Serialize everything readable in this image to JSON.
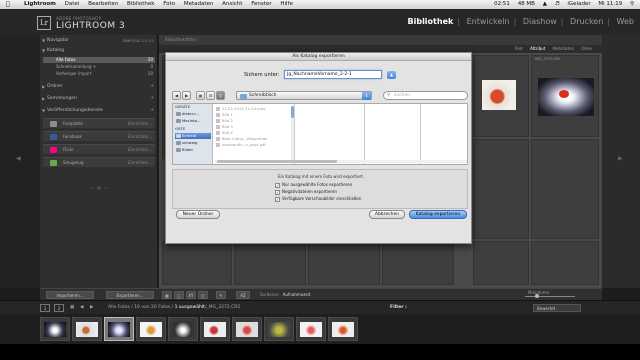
{
  "menubar": {
    "app": "Lightroom",
    "menus": [
      "Datei",
      "Bearbeiten",
      "Bibliothek",
      "Foto",
      "Metadaten",
      "Ansicht",
      "Fenster",
      "Hilfe"
    ],
    "time_left": "02:51",
    "memory": "48 MB",
    "user": "iGelader",
    "clock": "Mi 11:19"
  },
  "app": {
    "badge": "Lr",
    "small": "ADOBE PHOTOSHOP",
    "title": "LIGHTROOM 3",
    "modules": [
      "Bibliothek",
      "Entwickeln",
      "Diashow",
      "Drucken",
      "Web"
    ],
    "active_module": "Bibliothek"
  },
  "left_panel": {
    "navigator": "Navigator",
    "navigator_modes": "EINP  FÜLL  1:1  3:1",
    "catalog": "Katalog",
    "catalog_items": [
      {
        "label": "Alle Fotos",
        "count": "20"
      },
      {
        "label": "Schnellsammlung +",
        "count": "0"
      },
      {
        "label": "Vorheriger Import",
        "count": "20"
      }
    ],
    "folders": "Ordner",
    "collections": "Sammlungen",
    "publish": "Veröffentlichungsdienste",
    "publish_items": [
      {
        "label": "Festplatte",
        "btn": "Einrichten...",
        "color": "#8d8d8d"
      },
      {
        "label": "Facebook",
        "btn": "Einrichten...",
        "color": "#3b5998"
      },
      {
        "label": "Flickr",
        "btn": "Einrichten...",
        "color": "#ff0084"
      },
      {
        "label": "Smugmug",
        "btn": "Einrichten...",
        "color": "#6aa84f"
      }
    ]
  },
  "main": {
    "crumb": "Bibliotheksfilter :",
    "filters": [
      "Text",
      "Attribut",
      "Metadaten",
      "Ohne"
    ],
    "active_filter": "Attribut",
    "cell_label": "IMG_3270.CR2"
  },
  "dialog": {
    "title": "Als Katalog exportieren",
    "save_as_label": "Sichern unter:",
    "save_as_value": "Jg_NachnameVorname_2-2-1",
    "location": "Schreibtisch",
    "search_placeholder": "suchen",
    "sidebar": {
      "devices_head": "GERÄTE",
      "devices": [
        "dieter-r...",
        "Macinto..."
      ],
      "places_head": "ORTE",
      "places": [
        "Schreib",
        "schweig",
        "Bilder"
      ],
      "selected_place": "Schreib"
    },
    "files": [
      "22.02.2011 21-24.mov",
      "Bild 1",
      "Bild 2",
      "Bild 3",
      "Bild 4",
      "Boot Camp...nfiguration",
      "dauerauftr...n_pass.pdf"
    ],
    "info": "Ein Katalog mit einem Foto wird exportiert.",
    "options": [
      {
        "label": "Nur ausgewählte Fotos exportieren",
        "checked": "✓"
      },
      {
        "label": "Negativdateien exportieren",
        "checked": "✓"
      },
      {
        "label": "Verfügbare Vorschaubilder einschließen",
        "checked": "✓"
      }
    ],
    "new_folder": "Neuer Ordner",
    "cancel": "Abbrechen",
    "export": "Katalog exportieren"
  },
  "toolbar": {
    "import": "Importieren...",
    "export": "Exportieren...",
    "sort_label": "Sortieren:",
    "sort_value": "Aufnahmezeit",
    "thumbs": "Miniaturen"
  },
  "filmbar": {
    "views": [
      "1",
      "2"
    ],
    "path_prefix": "Alle Fotos / 10 von 20 Fotos /",
    "selected": "1 ausgewählt",
    "file": "/_MG_3272.CR2",
    "filter_label": "Filter :",
    "rating": "Bewertet"
  }
}
